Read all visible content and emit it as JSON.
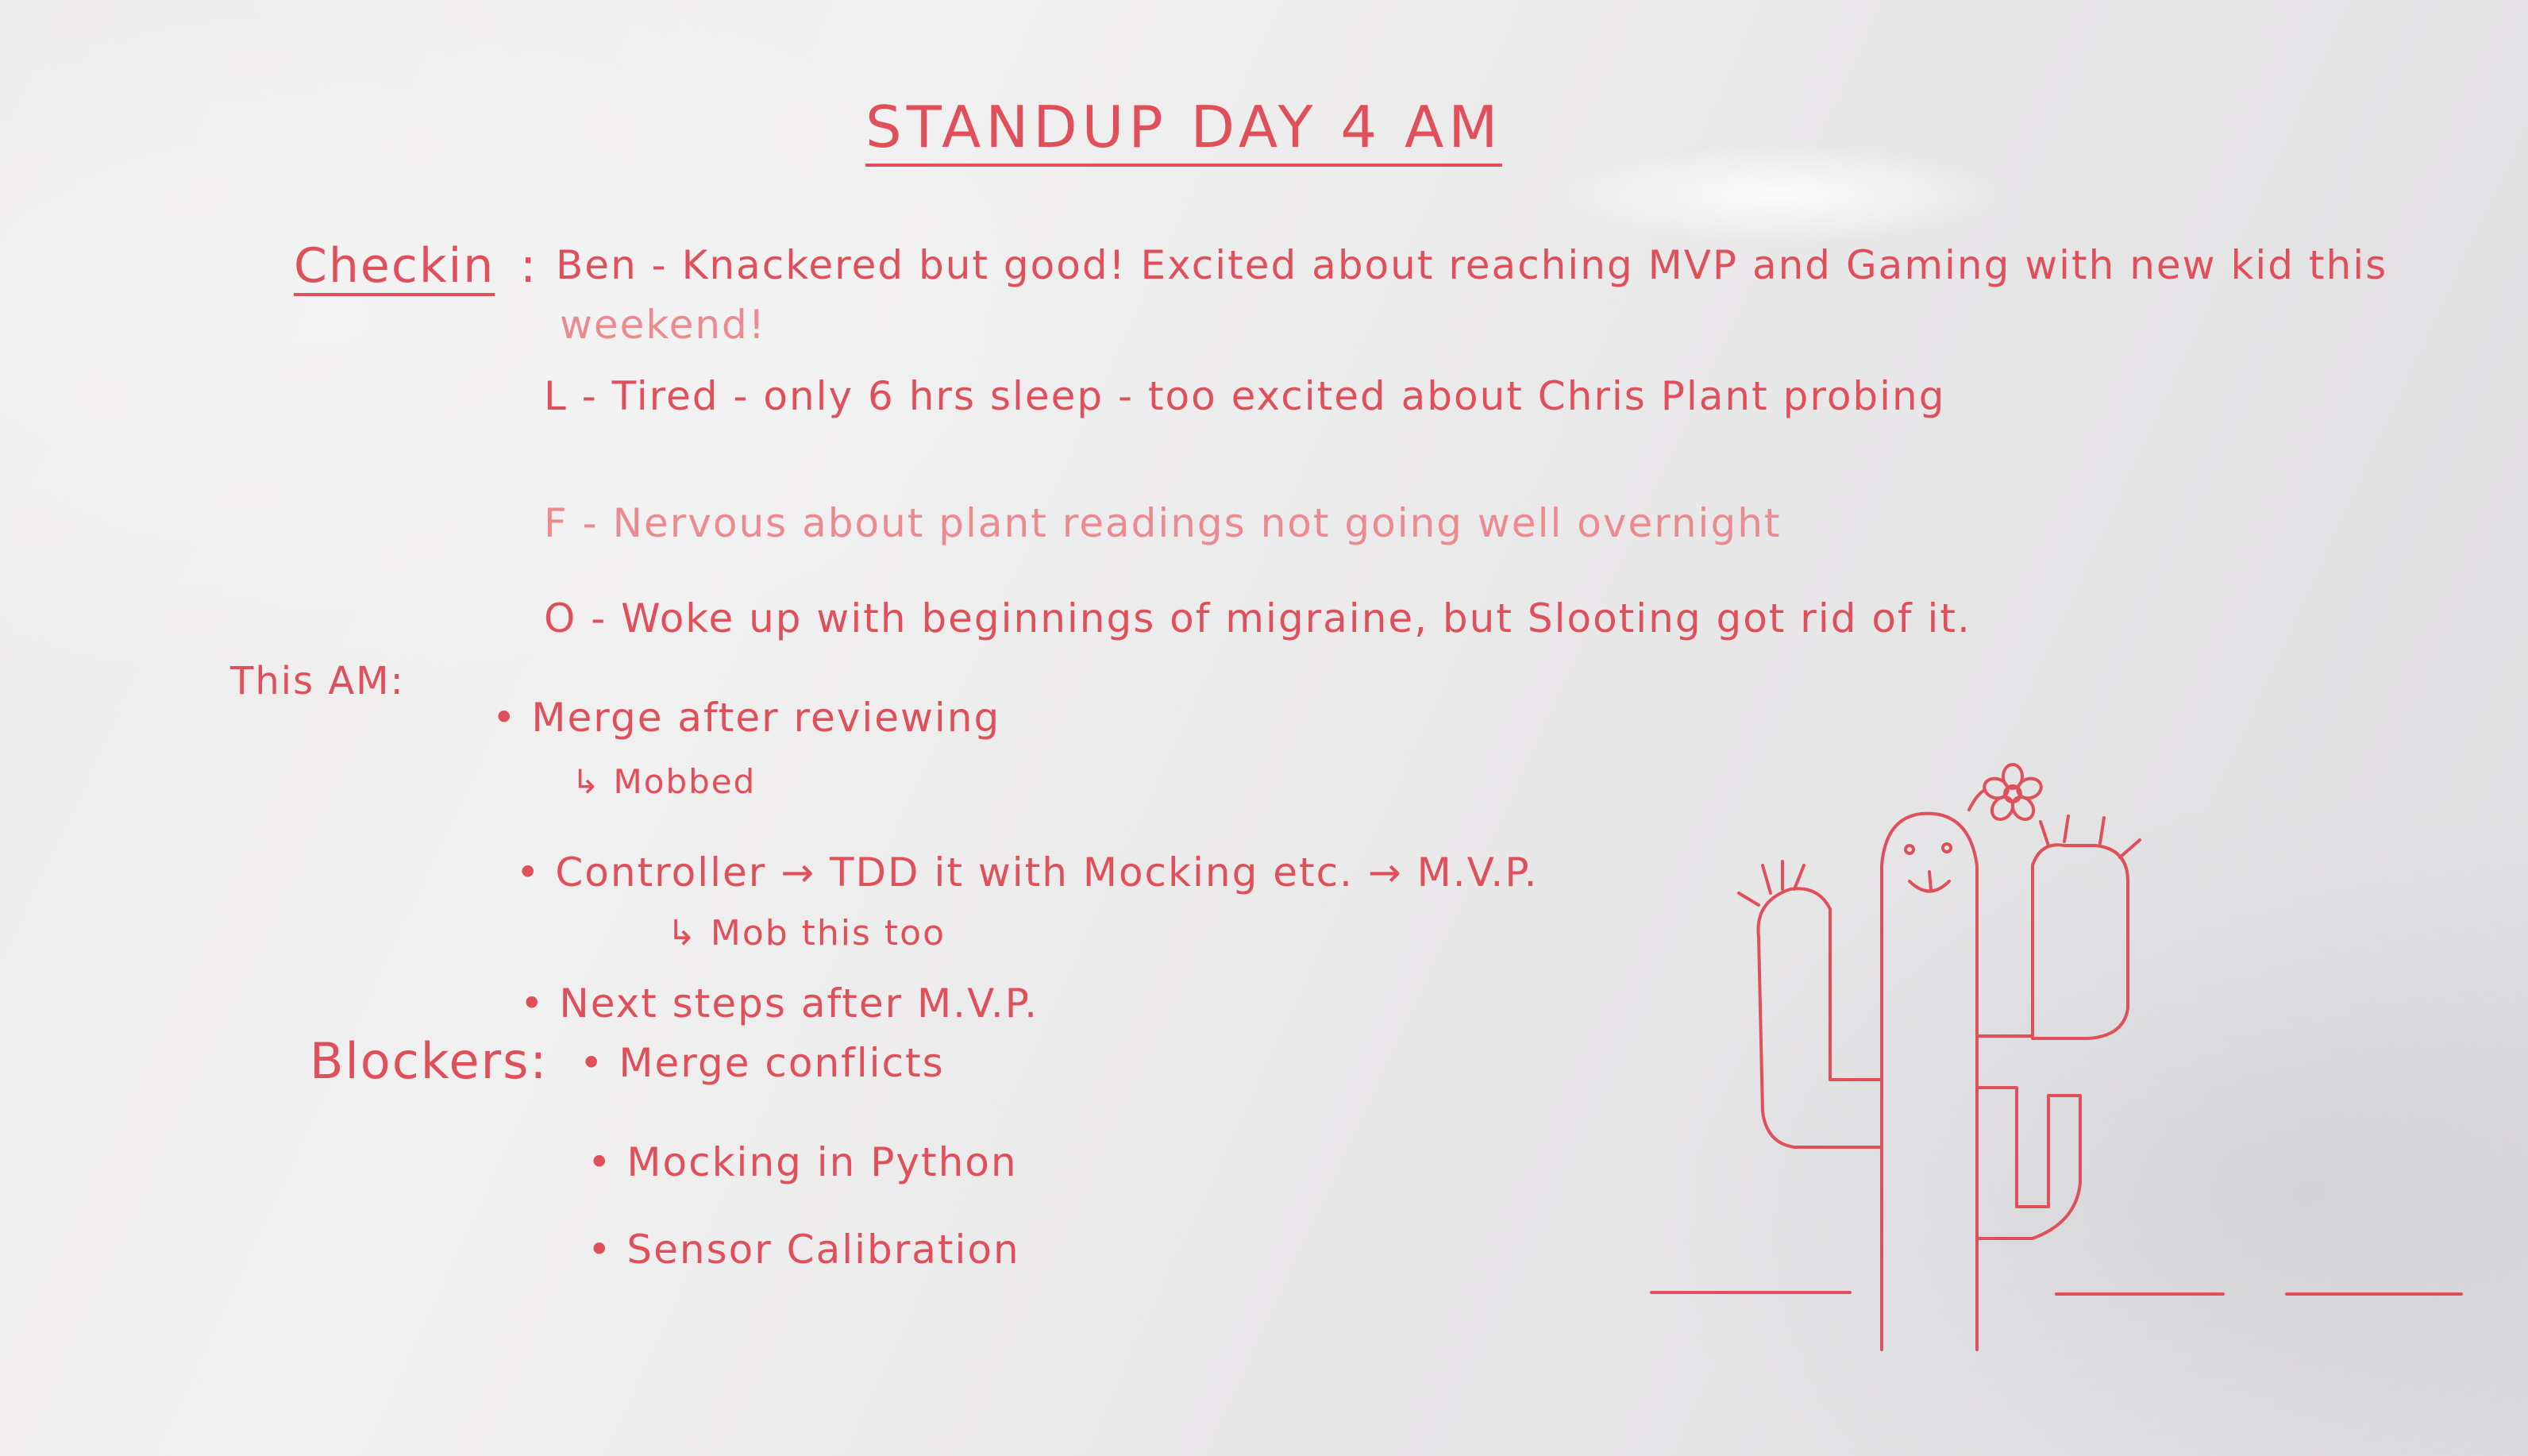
{
  "board": {
    "title": "STANDUP DAY 4 AM",
    "checkin": {
      "label": "Checkin",
      "entries": [
        {
          "initial": "Ben",
          "text": "Ben - Knackered but good! Excited about reaching MVP and Gaming with new kid this",
          "continued": "weekend!"
        },
        {
          "initial": "L",
          "text": "L - Tired - only 6 hrs sleep - too excited about Chris Plant probing"
        },
        {
          "initial": "F",
          "text": "F - Nervous about plant readings not going well overnight"
        },
        {
          "initial": "O",
          "text": "O - Woke up with beginnings of migraine, but Slooting got rid of it."
        }
      ]
    },
    "this_am": {
      "label": "This AM:",
      "items": [
        {
          "text": "• Merge after reviewing",
          "sub": "↳ Mobbed"
        },
        {
          "text": "• Controller → TDD it with Mocking etc. → M.V.P.",
          "sub": "↳ Mob this too"
        },
        {
          "text": "• Next steps after M.V.P."
        }
      ]
    },
    "blockers": {
      "label": "Blockers:",
      "items": [
        {
          "text": "• Merge conflicts"
        },
        {
          "text": "• Mocking in Python"
        },
        {
          "text": "• Sensor Calibration"
        }
      ]
    },
    "drawing": {
      "subject": "cactus-with-flower",
      "ink_color": "#e0505a",
      "board_color": "#eceaea"
    }
  }
}
